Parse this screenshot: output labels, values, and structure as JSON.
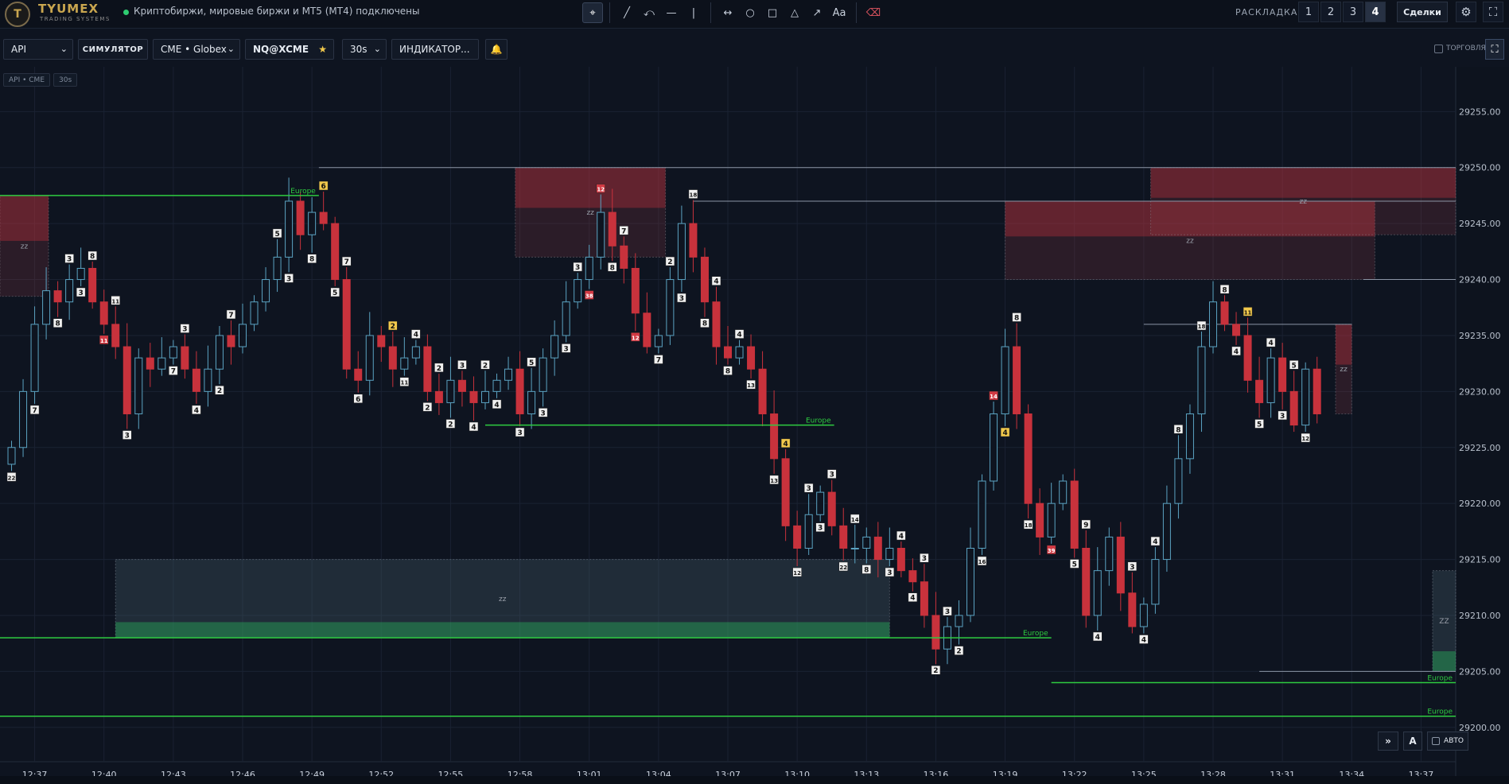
{
  "app": {
    "brand": "TYUMEX",
    "brand_sub": "TRADING SYSTEMS",
    "logo_glyph": "T",
    "status": "Криптобиржи, мировые биржи и MT5 (MT4) подключены",
    "status_color": "#2ecc71"
  },
  "draw_tools": [
    {
      "name": "cursor-icon",
      "glyph": "⌖"
    },
    {
      "name": "line-icon",
      "glyph": "╱"
    },
    {
      "name": "curve-icon",
      "glyph": "⤺"
    },
    {
      "name": "horizontal-line-icon",
      "glyph": "—"
    },
    {
      "name": "vertical-line-icon",
      "glyph": "|"
    },
    {
      "name": "measure-icon",
      "glyph": "↔"
    },
    {
      "name": "circle-icon",
      "glyph": "○"
    },
    {
      "name": "rectangle-icon",
      "glyph": "□"
    },
    {
      "name": "triangle-icon",
      "glyph": "△"
    },
    {
      "name": "arrow-icon",
      "glyph": "↗"
    },
    {
      "name": "text-icon",
      "glyph": "Aa"
    },
    {
      "name": "eraser-icon",
      "glyph": "⌫"
    }
  ],
  "layout": {
    "label": "РАСКЛАДКА",
    "options": [
      "1",
      "2",
      "3",
      "4"
    ],
    "active": "4"
  },
  "deals_label": "Сделки",
  "top_icons": {
    "settings": "⚙",
    "fullscreen": "⛶"
  },
  "toolbar": {
    "source": "API",
    "mode": "СИМУЛЯТОР",
    "exchange": "CME • Globex",
    "symbol": "NQ@XCME",
    "star": "★",
    "timeframe": "30s",
    "indicators": "ИНДИКАТОР...",
    "bell": "🔔",
    "trade_label": "ТОРГОВЛЯ",
    "expand": "⛶"
  },
  "chart_chips": [
    "API • CME",
    "30s"
  ],
  "bottom_controls": {
    "scroll": "»",
    "auto_scale": "A",
    "auto_label": "АВТО"
  },
  "chart_data": {
    "type": "candlestick",
    "symbol": "NQ@XCME",
    "timeframe": "30s",
    "ylim": [
      29197.5,
      29259
    ],
    "y_ticks": [
      29200,
      29205,
      29210,
      29215,
      29220,
      29225,
      29230,
      29235,
      29240,
      29245,
      29250,
      29255
    ],
    "x_ticks": [
      "12:37",
      "12:40",
      "12:43",
      "12:46",
      "12:49",
      "12:52",
      "12:55",
      "12:58",
      "13:01",
      "13:04",
      "13:07",
      "13:10",
      "13:13",
      "13:16",
      "13:19",
      "13:22",
      "13:25",
      "13:28",
      "13:31",
      "13:34",
      "13:37"
    ],
    "x_tick_minutes": [
      37,
      40,
      43,
      46,
      49,
      52,
      55,
      58,
      61,
      64,
      67,
      70,
      73,
      76,
      79,
      82,
      85,
      88,
      91,
      94,
      97
    ],
    "x_range_minutes": [
      35.5,
      98.5
    ],
    "grid": true,
    "colors": {
      "up": "#5ba3c2",
      "down": "#c8323c",
      "level": "#2ecc40",
      "label_text": "#2ecc40",
      "grid": "#1a2232"
    },
    "closes": [
      29225,
      29230,
      29236,
      29239,
      29238,
      29240,
      29241,
      29238,
      29236,
      29234,
      29228,
      29233,
      29232,
      29233,
      29234,
      29232,
      29230,
      29232,
      29235,
      29234,
      29236,
      29238,
      29240,
      29242,
      29247,
      29244,
      29246,
      29245,
      29240,
      29232,
      29231,
      29235,
      29234,
      29232,
      29233,
      29234,
      29230,
      29229,
      29231,
      29230,
      29229,
      29230,
      29231,
      29232,
      29228,
      29230,
      29233,
      29235,
      29238,
      29240,
      29242,
      29246,
      29243,
      29241,
      29237,
      29234,
      29235,
      29240,
      29245,
      29242,
      29238,
      29234,
      29233,
      29234,
      29232,
      29228,
      29224,
      29218,
      29216,
      29219,
      29221,
      29218,
      29216,
      29216,
      29217,
      29215,
      29216,
      29214,
      29213,
      29210,
      29207,
      29209,
      29210,
      29216,
      29222,
      29228,
      29234,
      29228,
      29220,
      29217,
      29220,
      29222,
      29216,
      29210,
      29214,
      29217,
      29212,
      29209,
      29211,
      29215,
      29220,
      29224,
      29228,
      29234,
      29238,
      29236,
      29235,
      29231,
      29229,
      29233,
      29230,
      29227,
      29232,
      29228
    ],
    "labels": [
      {
        "i": 0,
        "t": "22",
        "c": "w"
      },
      {
        "i": 2,
        "t": "7",
        "c": "w"
      },
      {
        "i": 4,
        "t": "8",
        "c": "w"
      },
      {
        "i": 5,
        "t": "3",
        "c": "w"
      },
      {
        "i": 6,
        "t": "3",
        "c": "w"
      },
      {
        "i": 7,
        "t": "8",
        "c": "w"
      },
      {
        "i": 8,
        "t": "11",
        "c": "r"
      },
      {
        "i": 9,
        "t": "11",
        "c": "w"
      },
      {
        "i": 10,
        "t": "3",
        "c": "w"
      },
      {
        "i": 14,
        "t": "7",
        "c": "w"
      },
      {
        "i": 15,
        "t": "3",
        "c": "w"
      },
      {
        "i": 16,
        "t": "4",
        "c": "w"
      },
      {
        "i": 18,
        "t": "2",
        "c": "w"
      },
      {
        "i": 19,
        "t": "7",
        "c": "w"
      },
      {
        "i": 23,
        "t": "5",
        "c": "w"
      },
      {
        "i": 24,
        "t": "3",
        "c": "w"
      },
      {
        "i": 26,
        "t": "8",
        "c": "w"
      },
      {
        "i": 27,
        "t": "6",
        "c": "y"
      },
      {
        "i": 28,
        "t": "5",
        "c": "w"
      },
      {
        "i": 29,
        "t": "7",
        "c": "w"
      },
      {
        "i": 30,
        "t": "6",
        "c": "w"
      },
      {
        "i": 33,
        "t": "2",
        "c": "y"
      },
      {
        "i": 34,
        "t": "11",
        "c": "w"
      },
      {
        "i": 35,
        "t": "4",
        "c": "w"
      },
      {
        "i": 36,
        "t": "2",
        "c": "w"
      },
      {
        "i": 37,
        "t": "2",
        "c": "w"
      },
      {
        "i": 38,
        "t": "2",
        "c": "w"
      },
      {
        "i": 39,
        "t": "3",
        "c": "w"
      },
      {
        "i": 40,
        "t": "4",
        "c": "w"
      },
      {
        "i": 41,
        "t": "2",
        "c": "w"
      },
      {
        "i": 42,
        "t": "4",
        "c": "w"
      },
      {
        "i": 44,
        "t": "3",
        "c": "w"
      },
      {
        "i": 45,
        "t": "5",
        "c": "w"
      },
      {
        "i": 46,
        "t": "3",
        "c": "w"
      },
      {
        "i": 48,
        "t": "3",
        "c": "w"
      },
      {
        "i": 49,
        "t": "3",
        "c": "w"
      },
      {
        "i": 50,
        "t": "38",
        "c": "r"
      },
      {
        "i": 51,
        "t": "12",
        "c": "r"
      },
      {
        "i": 52,
        "t": "8",
        "c": "w"
      },
      {
        "i": 53,
        "t": "7",
        "c": "w"
      },
      {
        "i": 54,
        "t": "12",
        "c": "r"
      },
      {
        "i": 56,
        "t": "7",
        "c": "w"
      },
      {
        "i": 57,
        "t": "2",
        "c": "w"
      },
      {
        "i": 58,
        "t": "3",
        "c": "w"
      },
      {
        "i": 59,
        "t": "18",
        "c": "w"
      },
      {
        "i": 60,
        "t": "8",
        "c": "w"
      },
      {
        "i": 61,
        "t": "4",
        "c": "w"
      },
      {
        "i": 62,
        "t": "8",
        "c": "w"
      },
      {
        "i": 63,
        "t": "4",
        "c": "w"
      },
      {
        "i": 64,
        "t": "13",
        "c": "w"
      },
      {
        "i": 66,
        "t": "13",
        "c": "w"
      },
      {
        "i": 67,
        "t": "4",
        "c": "y"
      },
      {
        "i": 68,
        "t": "12",
        "c": "w"
      },
      {
        "i": 69,
        "t": "3",
        "c": "w"
      },
      {
        "i": 70,
        "t": "3",
        "c": "w"
      },
      {
        "i": 71,
        "t": "3",
        "c": "w"
      },
      {
        "i": 72,
        "t": "22",
        "c": "w"
      },
      {
        "i": 73,
        "t": "14",
        "c": "w"
      },
      {
        "i": 74,
        "t": "8",
        "c": "w"
      },
      {
        "i": 76,
        "t": "3",
        "c": "w"
      },
      {
        "i": 77,
        "t": "4",
        "c": "w"
      },
      {
        "i": 78,
        "t": "4",
        "c": "w"
      },
      {
        "i": 79,
        "t": "3",
        "c": "w"
      },
      {
        "i": 80,
        "t": "2",
        "c": "w"
      },
      {
        "i": 81,
        "t": "3",
        "c": "w"
      },
      {
        "i": 82,
        "t": "2",
        "c": "w"
      },
      {
        "i": 84,
        "t": "16",
        "c": "w"
      },
      {
        "i": 85,
        "t": "14",
        "c": "r"
      },
      {
        "i": 86,
        "t": "4",
        "c": "y"
      },
      {
        "i": 87,
        "t": "8",
        "c": "w"
      },
      {
        "i": 88,
        "t": "18",
        "c": "w"
      },
      {
        "i": 90,
        "t": "39",
        "c": "r"
      },
      {
        "i": 92,
        "t": "5",
        "c": "w"
      },
      {
        "i": 93,
        "t": "9",
        "c": "w"
      },
      {
        "i": 94,
        "t": "4",
        "c": "w"
      },
      {
        "i": 97,
        "t": "3",
        "c": "w"
      },
      {
        "i": 98,
        "t": "4",
        "c": "w"
      },
      {
        "i": 99,
        "t": "4",
        "c": "w"
      },
      {
        "i": 101,
        "t": "8",
        "c": "w"
      },
      {
        "i": 103,
        "t": "18",
        "c": "w"
      },
      {
        "i": 105,
        "t": "8",
        "c": "w"
      },
      {
        "i": 106,
        "t": "4",
        "c": "w"
      },
      {
        "i": 107,
        "t": "11",
        "c": "y"
      },
      {
        "i": 108,
        "t": "5",
        "c": "w"
      },
      {
        "i": 109,
        "t": "4",
        "c": "w"
      },
      {
        "i": 110,
        "t": "3",
        "c": "w"
      },
      {
        "i": 111,
        "t": "5",
        "c": "w"
      },
      {
        "i": 112,
        "t": "12",
        "c": "w"
      }
    ],
    "levels": [
      {
        "price": 29247.5,
        "x0_min": 35.5,
        "x1_min": 49.3,
        "label": "Europe"
      },
      {
        "price": 29227,
        "x0_min": 56.5,
        "x1_min": 71.6,
        "label": "Europe"
      },
      {
        "price": 29208,
        "x0_min": 35.5,
        "x1_min": 81,
        "label": "Europe"
      },
      {
        "price": 29204,
        "x0_min": 81,
        "x1_min": 98.5,
        "label": "Europe"
      },
      {
        "price": 29201,
        "x0_min": 35.5,
        "x1_min": 98.5,
        "label": "Europe"
      }
    ],
    "gray_lines": [
      {
        "price": 29250,
        "x0_min": 49.3,
        "x1_min": 98.5
      },
      {
        "price": 29247,
        "x0_min": 65.5,
        "x1_min": 98.5
      },
      {
        "price": 29240,
        "x0_min": 94.5,
        "x1_min": 98.5
      },
      {
        "price": 29236,
        "x0_min": 85,
        "x1_min": 94
      },
      {
        "price": 29205,
        "x0_min": 90,
        "x1_min": 98.5
      }
    ],
    "zones": [
      {
        "kind": "supply",
        "top": 29247.5,
        "bottom": 29238.5,
        "x0_min": 35.5,
        "x1_min": 37.6,
        "label": "zz"
      },
      {
        "kind": "supply",
        "top": 29250,
        "bottom": 29242,
        "x0_min": 57.8,
        "x1_min": 64.3,
        "label": "zz"
      },
      {
        "kind": "supply",
        "top": 29247,
        "bottom": 29240,
        "x0_min": 79,
        "x1_min": 95,
        "label": "zz"
      },
      {
        "kind": "supply",
        "top": 29250,
        "bottom": 29244,
        "x0_min": 85.3,
        "x1_min": 98.5,
        "label": "zz"
      },
      {
        "kind": "supply",
        "top": 29236,
        "bottom": 29228,
        "x0_min": 93.3,
        "x1_min": 94,
        "label": "zz"
      },
      {
        "kind": "demand",
        "top": 29215,
        "bottom": 29208,
        "x0_min": 40.5,
        "x1_min": 74,
        "label": "zz"
      },
      {
        "kind": "demand",
        "top": 29214,
        "bottom": 29205,
        "x0_min": 97.5,
        "x1_min": 98.5,
        "label": "ZZ"
      }
    ]
  }
}
